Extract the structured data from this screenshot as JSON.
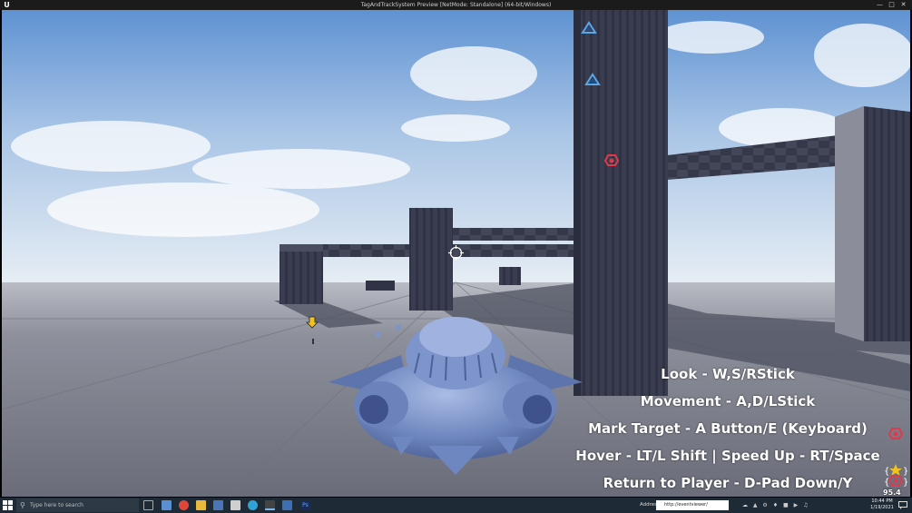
{
  "window": {
    "title": "TagAndTrackSystem Preview [NetMode: Standalone]  (64-bit/Windows)",
    "app_logo": "U",
    "controls": [
      "minimize",
      "maximize",
      "close"
    ]
  },
  "hud": {
    "instructions": [
      "Look - W,S/RStick",
      "Movement - A,D/LStick",
      "Mark Target - A Button/E (Keyboard)",
      "Hover - LT/L Shift | Speed Up - RT/Space",
      "Return to Player - D-Pad Down/Y"
    ],
    "distance": "95.4 m",
    "markers": {
      "blue_triangle": "triangle-marker-icon",
      "red_hexagon": "hexagon-marker-icon",
      "yellow_star": "star-marker-icon",
      "yellow_arrow": "arrow-down-marker-icon"
    }
  },
  "taskbar": {
    "search_placeholder": "Type here to search",
    "address_label": "Address",
    "address_value": "http://eventviewer/",
    "time": "10:44 PM",
    "date": "1/19/2021"
  },
  "colors": {
    "sky_top": "#6f9fd6",
    "sky_bottom": "#d9e6f2",
    "floor": "#7c7f8a",
    "pillar": "#3c3f52",
    "ship": "#7c94c7",
    "marker_blue": "#5aa7e8",
    "marker_red": "#e0394b",
    "marker_yellow": "#f2c21e"
  }
}
